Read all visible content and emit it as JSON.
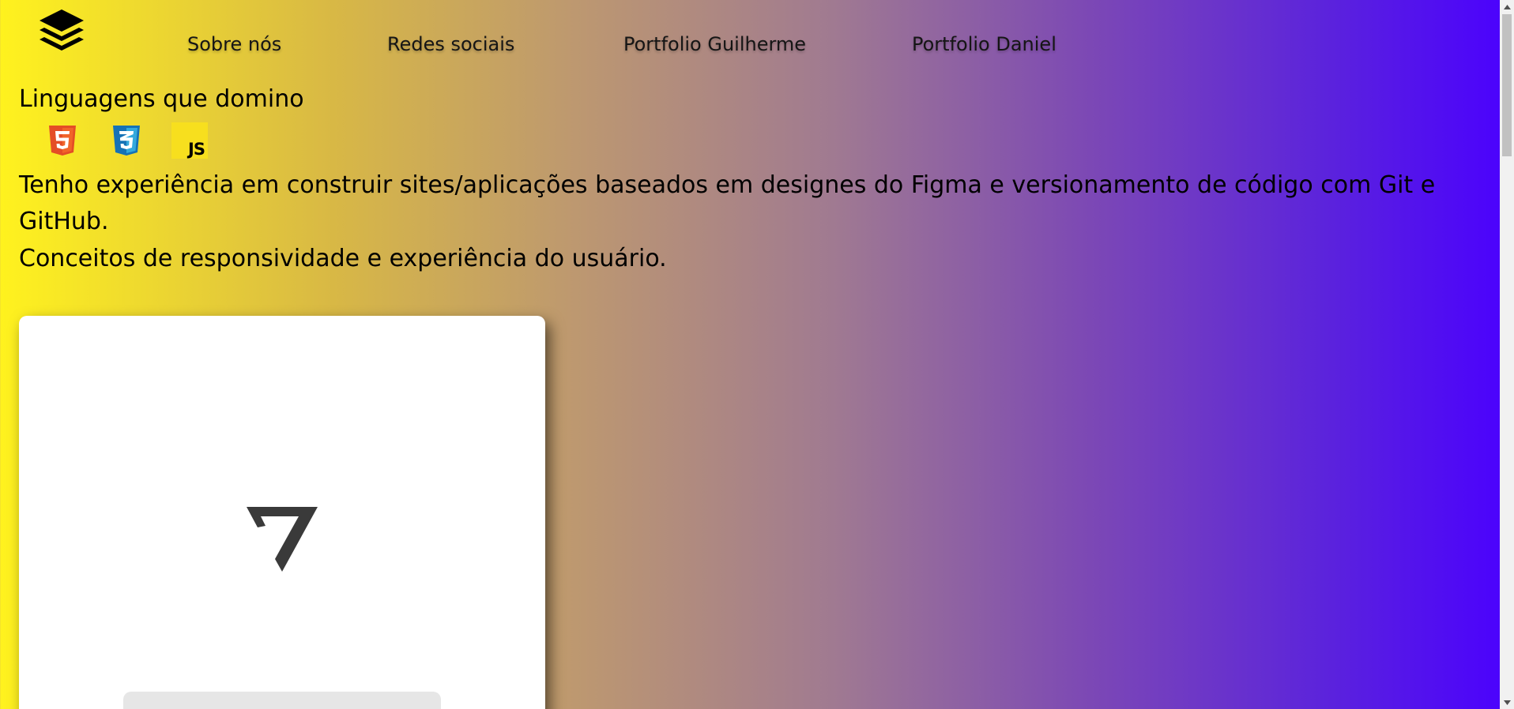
{
  "nav": {
    "items": [
      {
        "label": "Sobre nós"
      },
      {
        "label": "Redes sociais"
      },
      {
        "label": "Portfolio Guilherme"
      },
      {
        "label": "Portfolio Daniel"
      }
    ]
  },
  "languages": {
    "heading": "Linguagens que domino",
    "icons": [
      "html5-icon",
      "css3-icon",
      "javascript-icon"
    ],
    "js_label": "JS"
  },
  "experience": {
    "line1": "Tenho experiência em construir sites/aplicações baseados em designes do Figma e versionamento de código com Git e GitHub.",
    "line2": "Conceitos de responsividade e experiência do usuário."
  },
  "icons": {
    "logo": "stacked-layers-icon",
    "card_logo": "vercel-v-icon"
  },
  "colors": {
    "gradient_start": "#fff21e",
    "gradient_end": "#4a00ff",
    "html5": "#e44d26",
    "css3": "#1572b6",
    "js": "#f7df1e"
  }
}
